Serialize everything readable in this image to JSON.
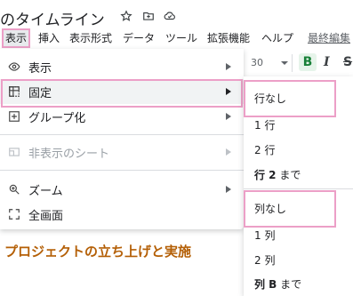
{
  "title": {
    "text": "のタイムライン",
    "icons": [
      "star-icon",
      "move-to-folder-icon",
      "cloud-status-icon"
    ]
  },
  "menubar": {
    "items": [
      "表示",
      "挿入",
      "表示形式",
      "データ",
      "ツール",
      "拡張機能",
      "ヘルプ"
    ],
    "active": "表示",
    "last_edit": "最終編集"
  },
  "dropdown": {
    "items": [
      {
        "label": "表示",
        "icon": "eye-icon",
        "has_submenu": true,
        "disabled": false
      },
      {
        "label": "固定",
        "icon": "freeze-icon",
        "has_submenu": true,
        "disabled": false,
        "highlighted": true
      },
      {
        "label": "グループ化",
        "icon": "group-plus-icon",
        "has_submenu": true,
        "disabled": false
      },
      {
        "label": "非表示のシート",
        "icon": "hidden-sheet-icon",
        "has_submenu": true,
        "disabled": true
      },
      {
        "label": "ズーム",
        "icon": "zoom-icon",
        "has_submenu": true,
        "disabled": false
      },
      {
        "label": "全画面",
        "icon": "fullscreen-icon",
        "has_submenu": false,
        "disabled": false
      }
    ]
  },
  "toolbar": {
    "font_size": "30",
    "bold": "B",
    "italic": "I",
    "strikethrough": "S"
  },
  "submenu": {
    "rows": [
      {
        "label": "行なし",
        "boxed": true
      },
      {
        "label": "1 行"
      },
      {
        "label": "2 行"
      },
      {
        "label_bold": "行 2",
        "label_rest": " まで"
      }
    ],
    "columns": [
      {
        "label": "列なし",
        "boxed": true
      },
      {
        "label": "1 列"
      },
      {
        "label": "2 列"
      },
      {
        "label_bold": "列 B",
        "label_rest": " まで"
      }
    ]
  },
  "document": {
    "heading": "プロジェクトの立ち上げと実施"
  },
  "colors": {
    "highlight_outline": "#ec9fc7",
    "heading_color": "#b45f06",
    "bold_active": "#188038"
  }
}
